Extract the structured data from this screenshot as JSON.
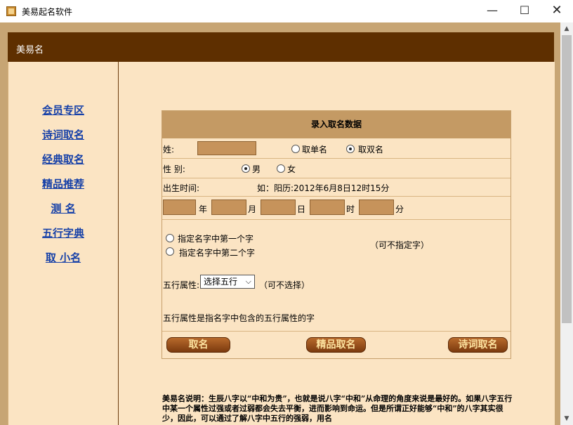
{
  "window": {
    "title": "美易起名软件",
    "min_glyph": "—",
    "max_glyph": "☐",
    "close_glyph": "✕"
  },
  "header": {
    "title": "美易名"
  },
  "sidebar": {
    "items": [
      {
        "label": "会员专区"
      },
      {
        "label": "诗词取名"
      },
      {
        "label": "经典取名"
      },
      {
        "label": "精品推荐"
      },
      {
        "label": "测 名"
      },
      {
        "label": "五行字典"
      },
      {
        "label": "取 小名"
      }
    ]
  },
  "form": {
    "title": "录入取名数据",
    "surname": {
      "label": "姓:",
      "value": ""
    },
    "name_type": {
      "single": "取单名",
      "double": "取双名",
      "selected": "double"
    },
    "gender": {
      "label": "性 别:",
      "male": "男",
      "female": "女",
      "selected": "male"
    },
    "birth": {
      "label": "出生时间:",
      "example": "如：阳历:2012年6月8日12时15分",
      "year_unit": "年",
      "month_unit": "月",
      "day_unit": "日",
      "hour_unit": "时",
      "minute_unit": "分"
    },
    "specify": {
      "first": "指定名字中第一个字",
      "second": "指定名字中第二个字",
      "note": "（可不指定字）"
    },
    "wuxing": {
      "label": "五行属性:",
      "selected": "选择五行",
      "note": "（可不选择）",
      "explain": "五行属性是指名字中包含的五行属性的字"
    },
    "buttons": {
      "quming": "取名",
      "jingpin": "精品取名",
      "shici": "诗词取名"
    }
  },
  "description": {
    "text": "美易名说明：生辰八字以“中和为贵”，也就是说八字“中和”从命理的角度来说是最好的。如果八字五行中某一个属性过强或者过弱都会失去平衡，进而影响到命运。但是所谓正好能够“中和”的八字其实很少，因此，可以通过了解八字中五行的强弱，用名"
  },
  "colors": {
    "header_bg": "#5e2f00",
    "panel_bg": "#fbe4c3",
    "link": "#1640a8",
    "button": "#9a4f1c"
  }
}
